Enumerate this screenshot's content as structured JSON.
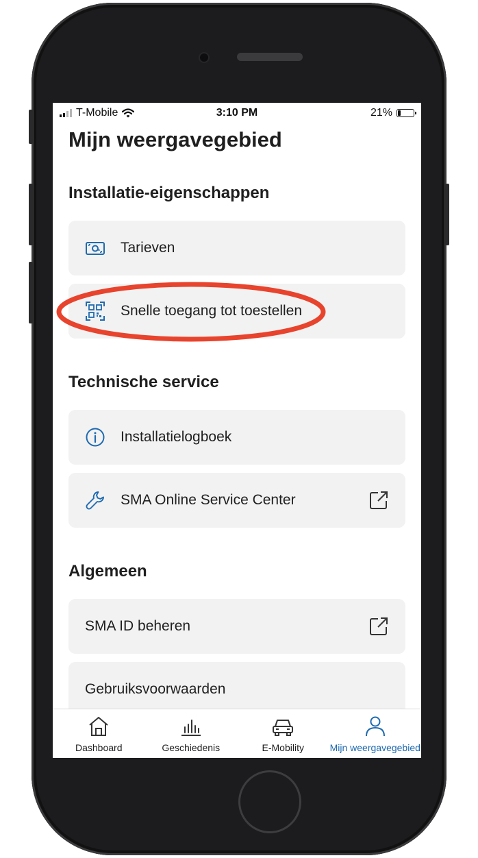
{
  "status_bar": {
    "carrier": "T-Mobile",
    "time": "3:10 PM",
    "battery_percent": "21%",
    "battery_level": 0.21
  },
  "page": {
    "title": "Mijn weergavegebied"
  },
  "sections": [
    {
      "title": "Installatie-eigenschappen",
      "items": [
        {
          "label": "Tarieven",
          "icon": "money-icon"
        },
        {
          "label": "Snelle toegang tot toestellen",
          "icon": "qr-code-icon"
        }
      ]
    },
    {
      "title": "Technische service",
      "items": [
        {
          "label": "Installatielogboek",
          "icon": "info-icon"
        },
        {
          "label": "SMA Online Service Center",
          "icon": "wrench-icon",
          "external": true
        }
      ]
    },
    {
      "title": "Algemeen",
      "items": [
        {
          "label": "SMA ID beheren",
          "external": true
        },
        {
          "label": "Gebruiksvoorwaarden"
        }
      ]
    }
  ],
  "tab_bar": {
    "tabs": [
      {
        "label": "Dashboard",
        "icon": "home-icon",
        "active": false
      },
      {
        "label": "Geschiedenis",
        "icon": "bar-chart-icon",
        "active": false
      },
      {
        "label": "E-Mobility",
        "icon": "car-icon",
        "active": false
      },
      {
        "label": "Mijn weergavegebied",
        "icon": "user-icon",
        "active": true
      }
    ]
  },
  "colors": {
    "accent": "#1e6ab0",
    "highlight_annotation": "#e8432d",
    "card_background": "#f2f2f2"
  }
}
